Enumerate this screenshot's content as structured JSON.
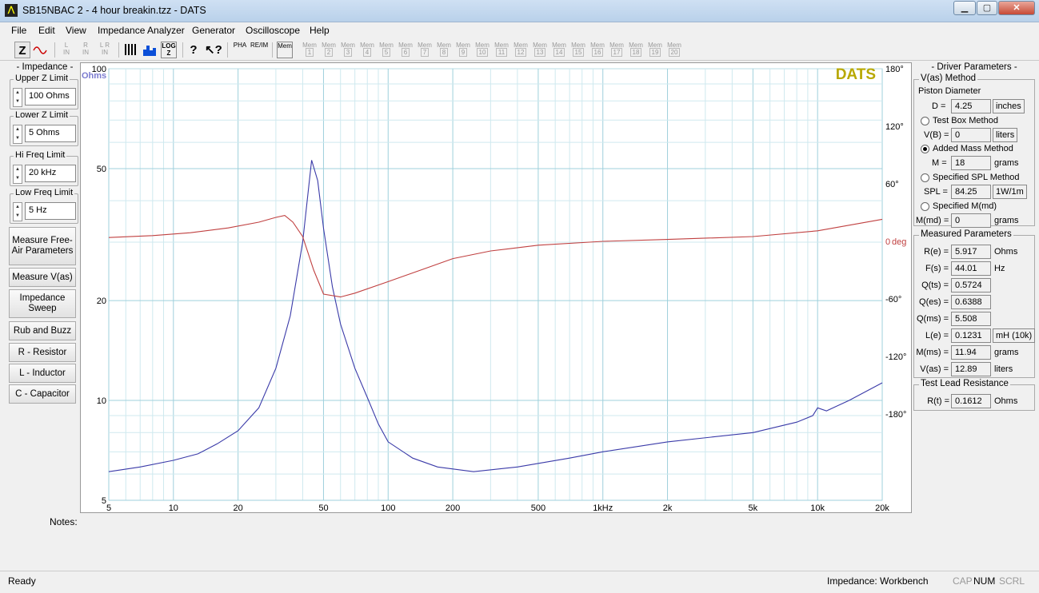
{
  "window": {
    "title": "SB15NBAC 2 - 4 hour breakin.tzz - DATS"
  },
  "menu": [
    "File",
    "Edit",
    "View",
    "Impedance Analyzer",
    "Generator",
    "Oscilloscope",
    "Help"
  ],
  "toolbar": {
    "z_label": "Z",
    "input_buttons": [
      "L IN",
      "R IN",
      "L R IN"
    ],
    "logz_label": "LOG Z",
    "pha_label": "PHA",
    "reim_label": "RE/IM",
    "mem_label": "Mem",
    "mem_slots": [
      "1",
      "2",
      "3",
      "4",
      "5",
      "6",
      "7",
      "8",
      "9",
      "10",
      "11",
      "12",
      "13",
      "14",
      "15",
      "16",
      "17",
      "18",
      "19",
      "20"
    ]
  },
  "left_panel": {
    "title": "- Impedance -",
    "upper_z": {
      "label": "Upper Z Limit",
      "value": "100 Ohms"
    },
    "lower_z": {
      "label": "Lower Z Limit",
      "value": "5 Ohms"
    },
    "hi_freq": {
      "label": "Hi Freq Limit",
      "value": "20 kHz"
    },
    "low_freq": {
      "label": "Low Freq Limit",
      "value": "5 Hz"
    },
    "buttons": [
      "Measure Free-Air Parameters",
      "Measure V(as)",
      "Impedance Sweep",
      "Rub and Buzz",
      "R - Resistor",
      "L - Inductor",
      "C - Capacitor"
    ]
  },
  "chart_data": {
    "type": "line",
    "brand_label": "DATS",
    "brand_color": "#b8a800",
    "left_unit": "Ohms",
    "right_unit": "deg",
    "x_scale": "log",
    "xlim": [
      5,
      20000
    ],
    "x_tick_labels": [
      "5",
      "10",
      "20",
      "50",
      "100",
      "200",
      "500",
      "1kHz",
      "2k",
      "5k",
      "10k",
      "20k"
    ],
    "x_tick_values": [
      5,
      10,
      20,
      50,
      100,
      200,
      500,
      1000,
      2000,
      5000,
      10000,
      20000
    ],
    "y_scale": "log",
    "ylim": [
      5,
      100
    ],
    "y_tick_labels": [
      "100",
      "50",
      "20",
      "10",
      "5"
    ],
    "y_tick_values": [
      100,
      50,
      20,
      10,
      5
    ],
    "y2lim": [
      -270,
      180
    ],
    "y2_tick_labels": [
      "180°",
      "120°",
      "60°",
      "0",
      "-60°",
      "-120°",
      "-180°"
    ],
    "y2_tick_values": [
      180,
      120,
      60,
      0,
      -60,
      -120,
      -180
    ],
    "grid": true,
    "series": [
      {
        "color": "#3a3aa8",
        "x": [
          5,
          7,
          10,
          13,
          16,
          20,
          25,
          30,
          35,
          40,
          44,
          47,
          50,
          55,
          60,
          70,
          80,
          90,
          100,
          130,
          170,
          250,
          400,
          700,
          1000,
          2000,
          5000,
          8000,
          9500,
          10000,
          11000,
          14000,
          20000
        ],
        "y": [
          6.1,
          6.3,
          6.6,
          6.9,
          7.4,
          8.1,
          9.5,
          12.5,
          18,
          30,
          53,
          46,
          33,
          22,
          17,
          12.5,
          10.2,
          8.5,
          7.5,
          6.7,
          6.3,
          6.1,
          6.3,
          6.7,
          7.0,
          7.5,
          8.0,
          8.6,
          9.0,
          9.5,
          9.3,
          10.0,
          11.3
        ]
      },
      {
        "color": "#c04040",
        "x": [
          5,
          8,
          12,
          18,
          25,
          30,
          33,
          36,
          40,
          45,
          50,
          60,
          70,
          100,
          150,
          200,
          300,
          500,
          1000,
          2000,
          5000,
          10000,
          20000
        ],
        "y": [
          4,
          6,
          9,
          14,
          20,
          25,
          27,
          20,
          5,
          -30,
          -55,
          -58,
          -54,
          -42,
          -28,
          -18,
          -10,
          -4,
          0,
          2,
          5,
          11,
          23
        ]
      }
    ]
  },
  "right_panel": {
    "title": "- Driver Parameters -",
    "vas_method": "V(as) Method",
    "piston_label": "Piston Diameter",
    "d": {
      "label": "D =",
      "value": "4.25",
      "unit": "inches"
    },
    "test_box": "Test Box Method",
    "vb": {
      "label": "V(B) =",
      "value": "0",
      "unit": "liters"
    },
    "added_mass": "Added Mass Method",
    "m": {
      "label": "M =",
      "value": "18",
      "unit": "grams"
    },
    "spl_method": "Specified SPL Method",
    "spl": {
      "label": "SPL =",
      "value": "84.25",
      "unit": "1W/1m"
    },
    "mmd_method": "Specified M(md)",
    "mmd": {
      "label": "M(md) =",
      "value": "0",
      "unit": "grams"
    },
    "measured_title": "Measured Parameters",
    "measured": [
      {
        "label": "R(e) =",
        "value": "5.917",
        "unit": "Ohms"
      },
      {
        "label": "F(s) =",
        "value": "44.01",
        "unit": "Hz"
      },
      {
        "label": "Q(ts) =",
        "value": "0.5724",
        "unit": ""
      },
      {
        "label": "Q(es) =",
        "value": "0.6388",
        "unit": ""
      },
      {
        "label": "Q(ms) =",
        "value": "5.508",
        "unit": ""
      },
      {
        "label": "L(e) =",
        "value": "0.1231",
        "unit": "mH (10k)"
      },
      {
        "label": "M(ms) =",
        "value": "11.94",
        "unit": "grams"
      },
      {
        "label": "V(as) =",
        "value": "12.89",
        "unit": "liters"
      }
    ],
    "lead_title": "Test Lead Resistance",
    "rt": {
      "label": "R(t) =",
      "value": "0.1612",
      "unit": "Ohms"
    }
  },
  "notes_label": "Notes:",
  "status": {
    "left": "Ready",
    "mode": "Impedance: Workbench",
    "cap": "CAP",
    "num": "NUM",
    "scrl": "SCRL"
  }
}
